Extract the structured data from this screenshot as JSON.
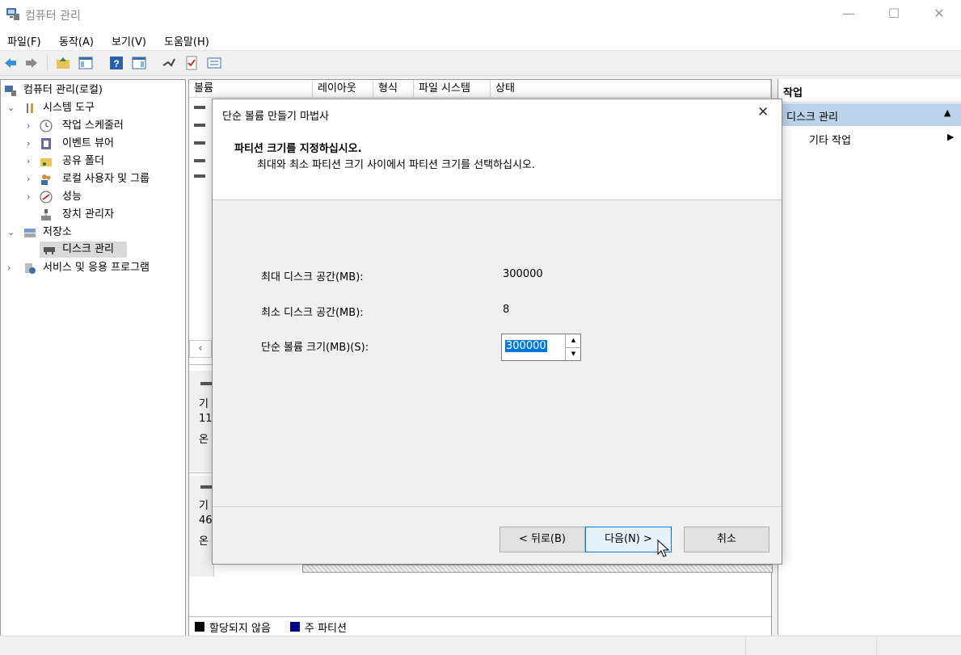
{
  "window": {
    "title": "컴퓨터 관리",
    "controls": {
      "minimize": "—",
      "maximize": "☐",
      "close": "✕"
    }
  },
  "menu": [
    "파일(F)",
    "동작(A)",
    "보기(V)",
    "도움말(H)"
  ],
  "tree": {
    "root": "컴퓨터 관리(로컬)",
    "system_tools": "시스템 도구",
    "task_scheduler": "작업 스케줄러",
    "event_viewer": "이벤트 뷰어",
    "shared_folders": "공유 폴더",
    "local_users": "로컬 사용자 및 그룹",
    "performance": "성능",
    "device_manager": "장치 관리자",
    "storage": "저장소",
    "disk_management": "디스크 관리",
    "services": "서비스 및 응용 프로그램"
  },
  "volume_columns": [
    "볼륨",
    "레이아웃",
    "형식",
    "파일 시스템",
    "상태"
  ],
  "disk_rows": [
    {
      "l1": "기",
      "l2": "11",
      "l3": "온"
    },
    {
      "l1": "기",
      "l2": "46",
      "l3": "온"
    }
  ],
  "legend": {
    "unallocated": "할당되지 않음",
    "primary": "주 파티션"
  },
  "actions": {
    "header": "작업",
    "group": "디스크 관리",
    "more": "기타 작업"
  },
  "dialog": {
    "title": "단순 볼륨 만들기 마법사",
    "heading": "파티션 크기를 지정하십시오.",
    "subheading": "최대와 최소 파티션 크기 사이에서 파티션 크기를 선택하십시오.",
    "max_label": "최대 디스크 공간(MB):",
    "max_value": "300000",
    "min_label": "최소 디스크 공간(MB):",
    "min_value": "8",
    "size_label": "단순 볼륨 크기(MB)(S):",
    "size_value": "300000",
    "back": "< 뒤로(B)",
    "next": "다음(N) >",
    "cancel": "취소",
    "close": "✕"
  },
  "colors": {
    "accent": "#0078d7",
    "selection": "#cce8ff",
    "primary_partition": "#00008b"
  }
}
